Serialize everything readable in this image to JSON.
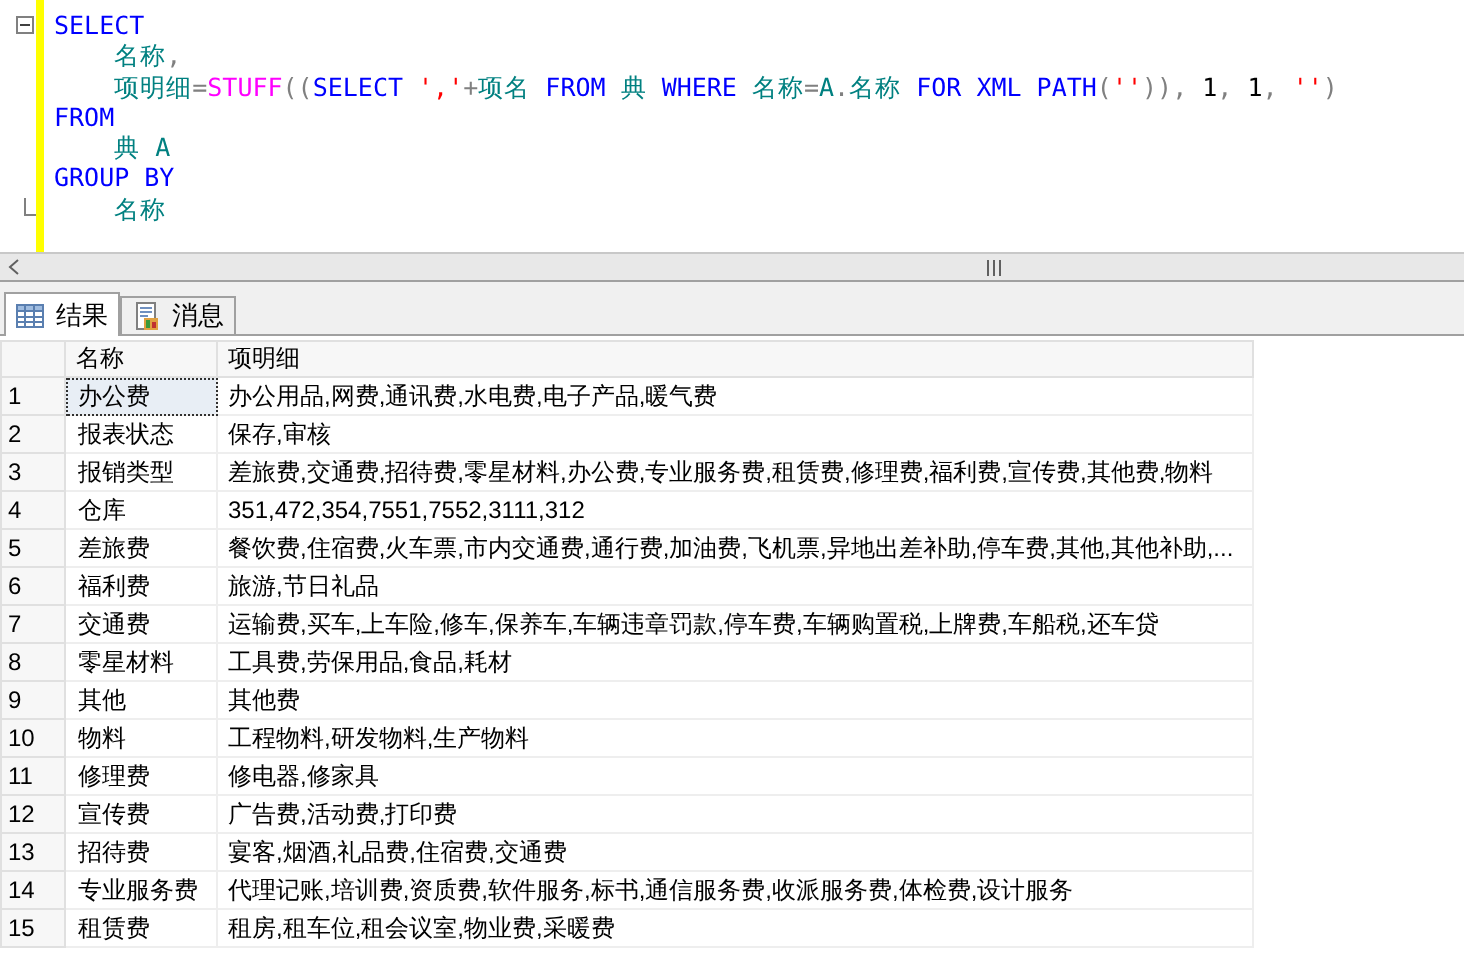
{
  "editor": {
    "lines": [
      {
        "kind": "fold_start",
        "tokens": [
          {
            "kind": "keyword",
            "text": "SELECT"
          }
        ]
      },
      {
        "kind": "plain",
        "tokens": [
          {
            "kind": "ident",
            "text": "    名称"
          },
          {
            "kind": "punct",
            "text": ","
          }
        ]
      },
      {
        "kind": "plain",
        "tokens": [
          {
            "kind": "ident",
            "text": "    项明细"
          },
          {
            "kind": "punct",
            "text": "="
          },
          {
            "kind": "func",
            "text": "STUFF"
          },
          {
            "kind": "punct",
            "text": "(("
          },
          {
            "kind": "keyword",
            "text": "SELECT "
          },
          {
            "kind": "string",
            "text": "','"
          },
          {
            "kind": "punct",
            "text": "+"
          },
          {
            "kind": "ident",
            "text": "项名"
          },
          {
            "kind": "keyword",
            "text": " FROM "
          },
          {
            "kind": "ident",
            "text": "典"
          },
          {
            "kind": "keyword",
            "text": " WHERE "
          },
          {
            "kind": "ident",
            "text": "名称"
          },
          {
            "kind": "punct",
            "text": "="
          },
          {
            "kind": "ident",
            "text": "A"
          },
          {
            "kind": "punct",
            "text": "."
          },
          {
            "kind": "ident",
            "text": "名称"
          },
          {
            "kind": "keyword",
            "text": " FOR XML PATH"
          },
          {
            "kind": "punct",
            "text": "("
          },
          {
            "kind": "string",
            "text": "''"
          },
          {
            "kind": "punct",
            "text": ")),"
          },
          {
            "kind": "number",
            "text": " 1"
          },
          {
            "kind": "punct",
            "text": ", "
          },
          {
            "kind": "number",
            "text": "1"
          },
          {
            "kind": "punct",
            "text": ", "
          },
          {
            "kind": "string",
            "text": "''"
          },
          {
            "kind": "punct",
            "text": ")"
          }
        ]
      },
      {
        "kind": "plain",
        "tokens": [
          {
            "kind": "keyword",
            "text": "FROM"
          }
        ]
      },
      {
        "kind": "plain",
        "tokens": [
          {
            "kind": "ident",
            "text": "    典 A"
          }
        ]
      },
      {
        "kind": "plain",
        "tokens": [
          {
            "kind": "keyword",
            "text": "GROUP BY"
          }
        ]
      },
      {
        "kind": "fold_end",
        "tokens": [
          {
            "kind": "ident",
            "text": "    名称"
          }
        ]
      }
    ]
  },
  "tabs": [
    {
      "label": "结果",
      "selected": true
    },
    {
      "label": "消息",
      "selected": false
    }
  ],
  "grid": {
    "columns": [
      "名称",
      "项明细"
    ],
    "rows": [
      {
        "num": "1",
        "name": "办公费",
        "detail": "办公用品,网费,通讯费,水电费,电子产品,暖气费",
        "selected": true
      },
      {
        "num": "2",
        "name": "报表状态",
        "detail": "保存,审核",
        "selected": false
      },
      {
        "num": "3",
        "name": "报销类型",
        "detail": "差旅费,交通费,招待费,零星材料,办公费,专业服务费,租赁费,修理费,福利费,宣传费,其他费,物料",
        "selected": false
      },
      {
        "num": "4",
        "name": "仓库",
        "detail": "351,472,354,7551,7552,3111,312",
        "selected": false
      },
      {
        "num": "5",
        "name": "差旅费",
        "detail": "餐饮费,住宿费,火车票,市内交通费,通行费,加油费,飞机票,异地出差补助,停车费,其他,其他补助,...",
        "selected": false
      },
      {
        "num": "6",
        "name": "福利费",
        "detail": "旅游,节日礼品",
        "selected": false
      },
      {
        "num": "7",
        "name": "交通费",
        "detail": "运输费,买车,上车险,修车,保养车,车辆违章罚款,停车费,车辆购置税,上牌费,车船税,还车贷",
        "selected": false
      },
      {
        "num": "8",
        "name": "零星材料",
        "detail": "工具费,劳保用品,食品,耗材",
        "selected": false
      },
      {
        "num": "9",
        "name": "其他",
        "detail": "其他费",
        "selected": false
      },
      {
        "num": "10",
        "name": "物料",
        "detail": "工程物料,研发物料,生产物料",
        "selected": false
      },
      {
        "num": "11",
        "name": "修理费",
        "detail": "修电器,修家具",
        "selected": false
      },
      {
        "num": "12",
        "name": "宣传费",
        "detail": "广告费,活动费,打印费",
        "selected": false
      },
      {
        "num": "13",
        "name": "招待费",
        "detail": "宴客,烟酒,礼品费,住宿费,交通费",
        "selected": false
      },
      {
        "num": "14",
        "name": "专业服务费",
        "detail": "代理记账,培训费,资质费,软件服务,标书,通信服务费,收派服务费,体检费,设计服务",
        "selected": false
      },
      {
        "num": "15",
        "name": "租赁费",
        "detail": "租房,租车位,租会议室,物业费,采暖费",
        "selected": false
      }
    ]
  }
}
